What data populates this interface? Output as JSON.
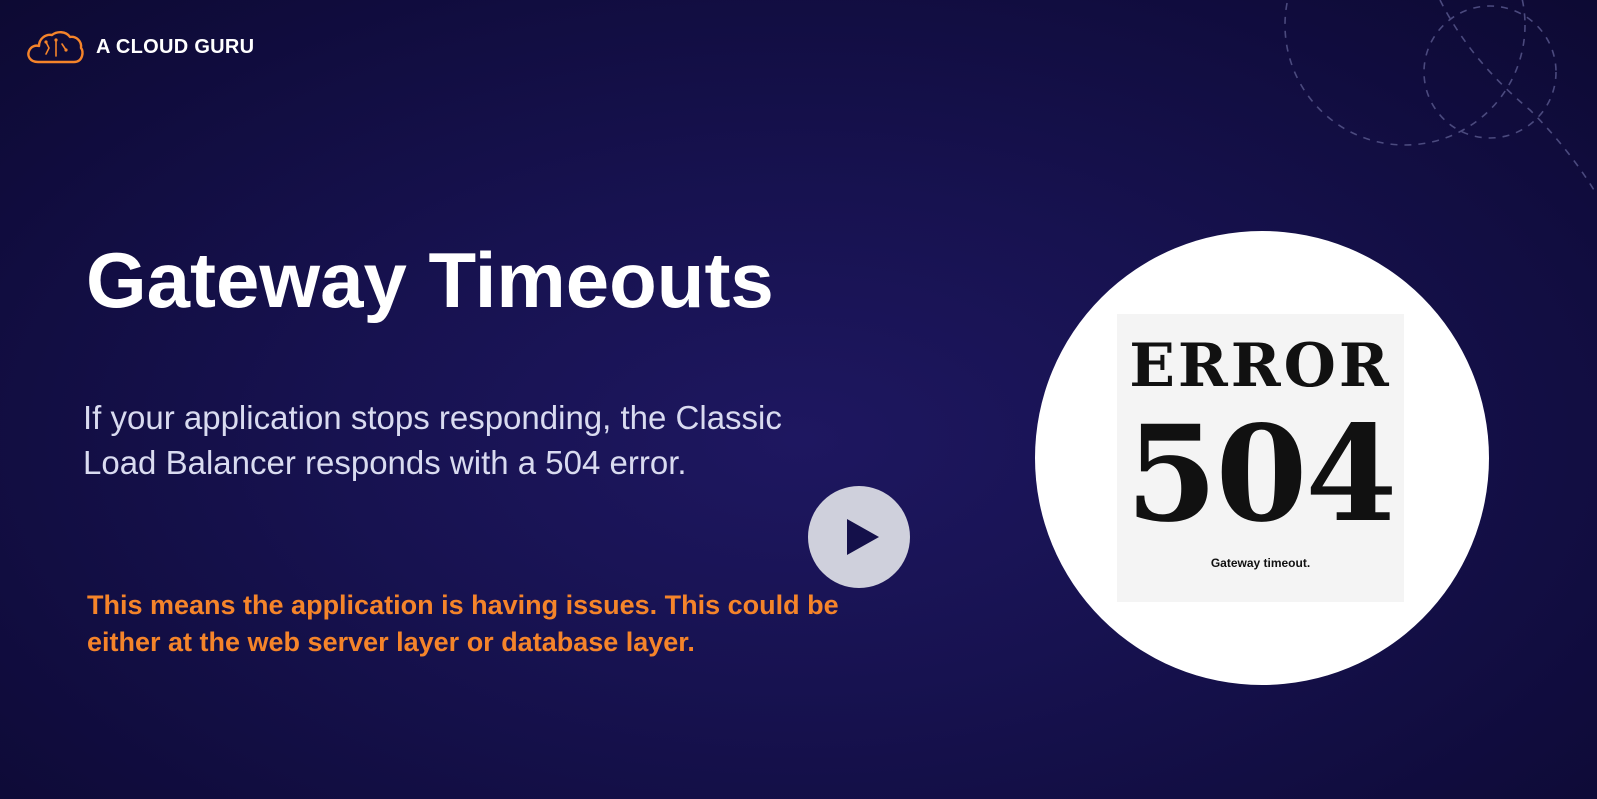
{
  "brand": {
    "name": "A CLOUD GURU",
    "icon": "cloud-logo-icon",
    "color": "#f5842a"
  },
  "slide": {
    "title": "Gateway Timeouts",
    "body": "If your application stops responding, the Classic Load Balancer responds with a 504 error.",
    "highlight": "This means the application is having issues. This could be either at the web server layer or database layer.",
    "highlight_color": "#f5842a"
  },
  "player": {
    "play_icon": "play-icon"
  },
  "image": {
    "error_word": "ERROR",
    "error_code": "504",
    "caption": "Gateway timeout."
  }
}
